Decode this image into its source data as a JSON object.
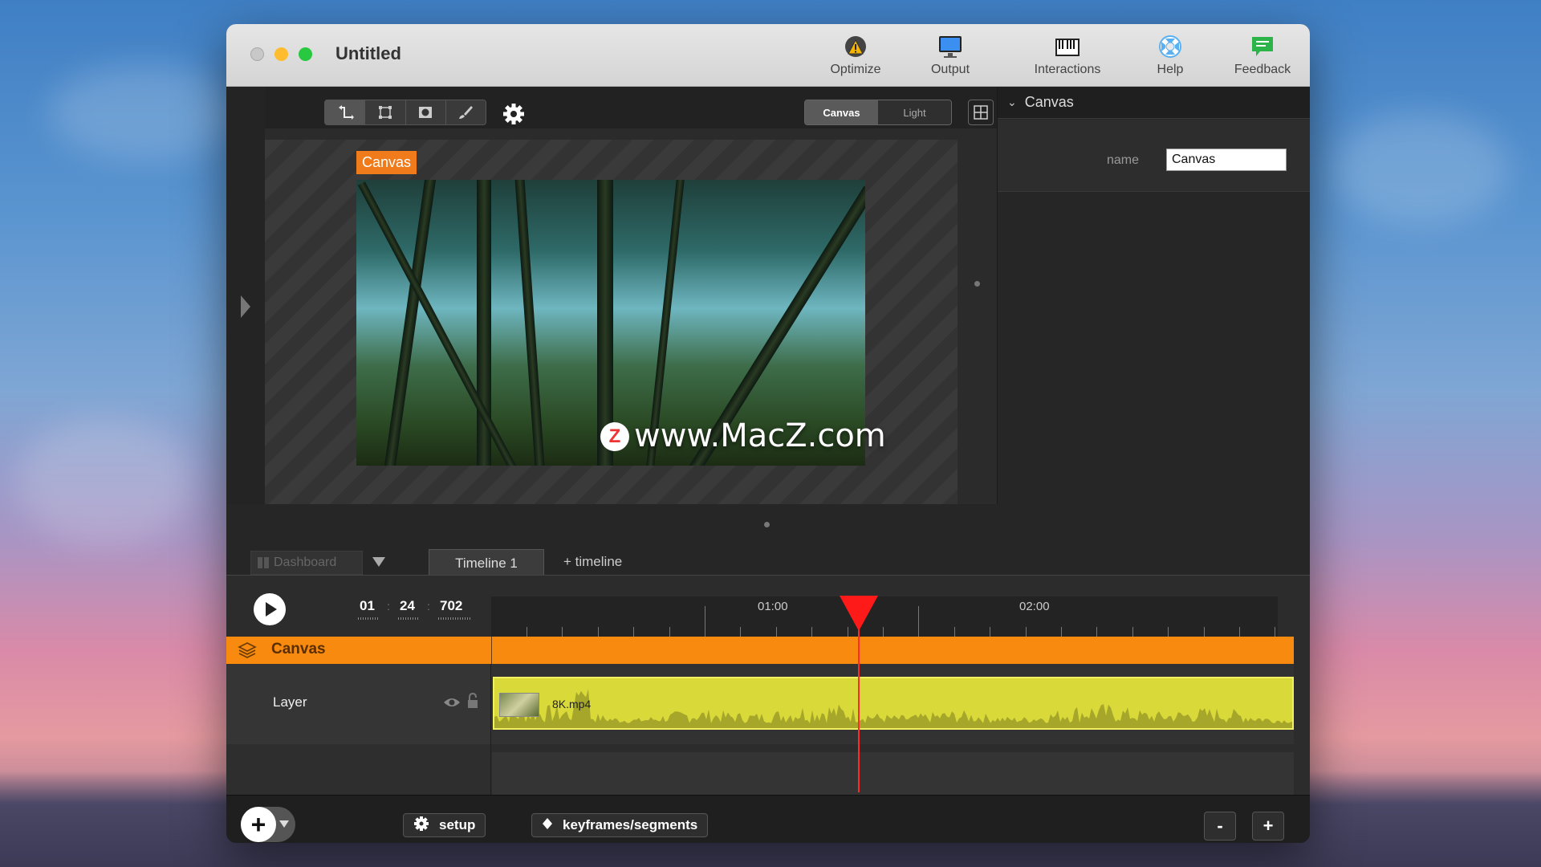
{
  "window": {
    "title": "Untitled"
  },
  "toolbar": {
    "items": [
      {
        "label": "Optimize",
        "icon": "optimize-warning-icon"
      },
      {
        "label": "Output",
        "icon": "monitor-icon"
      },
      {
        "label": "Interactions",
        "icon": "keyboard-icon"
      },
      {
        "label": "Help",
        "icon": "lifebuoy-icon"
      },
      {
        "label": "Feedback",
        "icon": "chat-bubble-icon"
      }
    ]
  },
  "view_mode": {
    "options": [
      "Canvas",
      "Light"
    ],
    "selected": "Canvas"
  },
  "stage": {
    "canvas_label": "Canvas",
    "watermark": "www.MacZ.com",
    "watermark_badge": "Z"
  },
  "inspector": {
    "section_title": "Canvas",
    "name_label": "name",
    "name_value": "Canvas"
  },
  "tabs": {
    "dashboard": "Dashboard",
    "timeline": "Timeline 1",
    "add_timeline": "+ timeline"
  },
  "timecode": {
    "minutes": "01",
    "seconds": "24",
    "frames": "702"
  },
  "ruler": {
    "labels": [
      "01:00",
      "02:00"
    ]
  },
  "tracks": {
    "group": {
      "label": "Canvas"
    },
    "layer": {
      "label": "Layer",
      "clip_name": "8K.mp4"
    }
  },
  "bottom": {
    "setup": "setup",
    "keyframes": "keyframes/segments",
    "zoom_out": "-",
    "zoom_in": "+"
  },
  "colors": {
    "accent_orange": "#f78a0f",
    "clip_yellow": "#d9d93a",
    "playhead": "#ff1a1a"
  }
}
